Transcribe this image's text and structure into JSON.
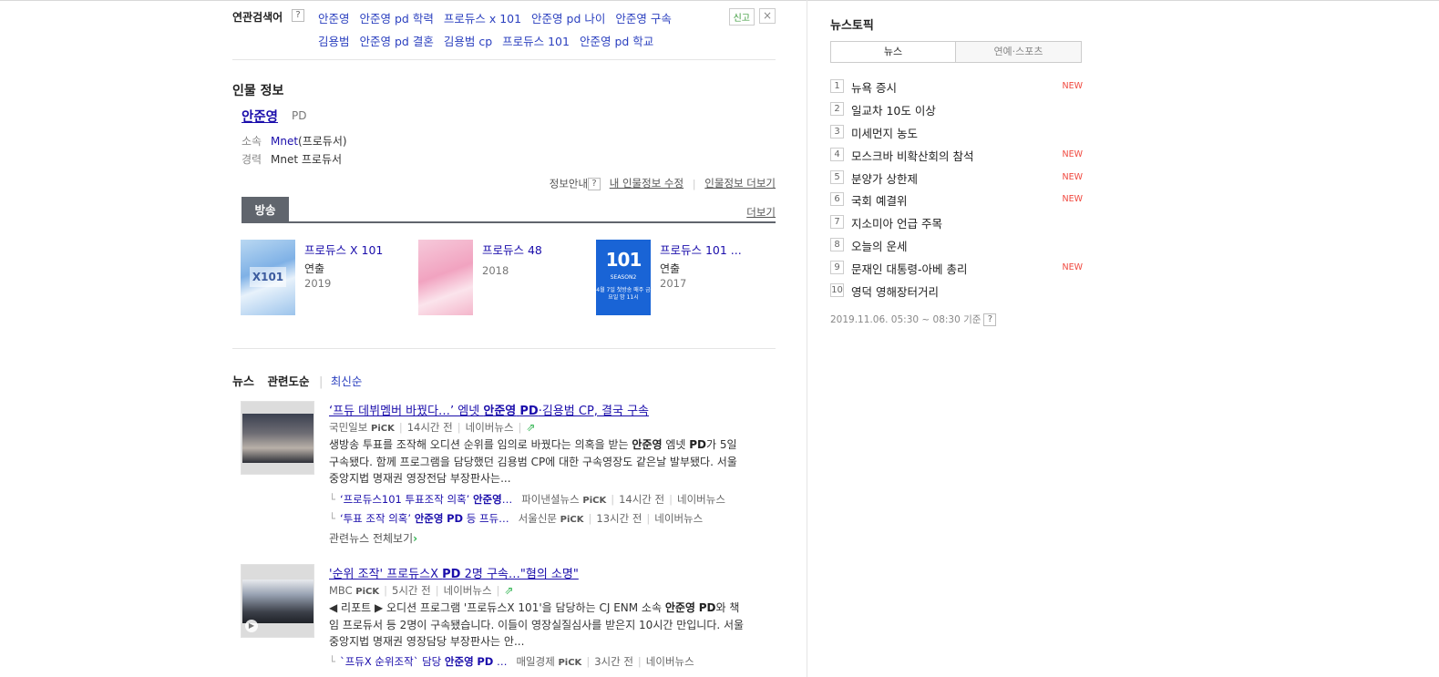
{
  "related": {
    "title": "연관검색어",
    "help": "?",
    "report": "신고",
    "close": "×",
    "links": [
      "안준영",
      "안준영 pd 학력",
      "프로듀스 x 101",
      "안준영 pd 나이",
      "안준영 구속",
      "김용범",
      "안준영 pd 결혼",
      "김용범 cp",
      "프로듀스 101",
      "안준영 pd 학교"
    ]
  },
  "person": {
    "heading": "인물 정보",
    "name": "안준영",
    "role": "PD",
    "affiliation_label": "소속",
    "affiliation_link": "Mnet",
    "affiliation_rest": "(프로듀서)",
    "career_label": "경력",
    "career_value": "Mnet 프로듀서",
    "info_guide": "정보안내",
    "info_help": "?",
    "edit": "내 인물정보 수정",
    "more": "인물정보 더보기"
  },
  "broadcast": {
    "tab": "방송",
    "more": "더보기",
    "items": [
      {
        "title": "프로듀스 X 101",
        "role": "연출",
        "year": "2019",
        "poster_text": "X101"
      },
      {
        "title": "프로듀스 48",
        "role": "",
        "year": "2018",
        "poster_text": ""
      },
      {
        "title": "프로듀스 101 ...",
        "role": "연출",
        "year": "2017",
        "poster_text": "101",
        "poster_sub": "SEASON2",
        "poster_air": "4월 7일 첫방송 매주 금요일 밤 11시"
      }
    ]
  },
  "news": {
    "heading": "뉴스",
    "sort_relevance": "관련도순",
    "sort_latest": "최신순",
    "articles": [
      {
        "title": "‘프듀 데뷔멤버 바꿨다…’ 엠넷 안준영 PD·김용범 CP, 결국 구속",
        "source": "국민일보",
        "pick": "PiCK",
        "time": "14시간 전",
        "portal": "네이버뉴스",
        "body_line1": "생방송 투표를 조작해 오디션 순위를 임의로 바꿨다는 의혹을 받는 안준영 엠넷 PD가 5일",
        "body_line2": "구속됐다. 함께 프로그램을 담당했던 김용범 CP에 대한 구속영장도 같은날 발부됐다. 서울",
        "body_line3": "중앙지법 명재권 영장전담 부장판사는...",
        "subs": [
          {
            "title": "‘프로듀스101 투표조작 의혹’ 안준영…",
            "source": "파이낸셜뉴스",
            "pick": "PiCK",
            "time": "14시간 전",
            "portal": "네이버뉴스"
          },
          {
            "title": "‘투표 조작 의혹’ 안준영 PD 등 프듀…",
            "source": "서울신문",
            "pick": "PiCK",
            "time": "13시간 전",
            "portal": "네이버뉴스"
          }
        ],
        "more": "관련뉴스 전체보기"
      },
      {
        "title": "'순위 조작' 프로듀스X PD 2명 구속…\"혐의 소명\"",
        "source": "MBC",
        "pick": "PiCK",
        "time": "5시간 전",
        "portal": "네이버뉴스",
        "body_line1": "◀ 리포트 ▶ 오디션 프로그램 '프로듀스X 101'을 담당하는 CJ ENM 소속 안준영 PD와 책",
        "body_line2": "임 프로듀서 등 2명이 구속됐습니다. 이들이 영장실질심사를 받은지 10시간 만입니다. 서울",
        "body_line3": "중앙지법 명재권 영장담당 부장판사는 안...",
        "subs": [
          {
            "title": "`프듀X 순위조작` 담당 안준영 PD …",
            "source": "매일경제",
            "pick": "PiCK",
            "time": "3시간 전",
            "portal": "네이버뉴스"
          }
        ]
      }
    ]
  },
  "side": {
    "heading": "뉴스토픽",
    "tab_news": "뉴스",
    "tab_ent": "연예·스포츠",
    "topics": [
      {
        "rank": "1",
        "text": "뉴욕 증시",
        "badge": "NEW"
      },
      {
        "rank": "2",
        "text": "일교차 10도 이상",
        "badge": ""
      },
      {
        "rank": "3",
        "text": "미세먼지 농도",
        "badge": ""
      },
      {
        "rank": "4",
        "text": "모스크바 비확산회의 참석",
        "badge": "NEW"
      },
      {
        "rank": "5",
        "text": "분양가 상한제",
        "badge": "NEW"
      },
      {
        "rank": "6",
        "text": "국회 예결위",
        "badge": "NEW"
      },
      {
        "rank": "7",
        "text": "지소미아 언급 주목",
        "badge": ""
      },
      {
        "rank": "8",
        "text": "오늘의 운세",
        "badge": ""
      },
      {
        "rank": "9",
        "text": "문재인 대통령-아베 총리",
        "badge": "NEW"
      },
      {
        "rank": "10",
        "text": "영덕 영해장터거리",
        "badge": ""
      }
    ],
    "basis": "2019.11.06. 05:30 ~ 08:30 기준",
    "basis_help": "?"
  },
  "colors": {
    "accent_link": "#1a0dab",
    "tab_dark": "#60656d",
    "new_badge": "#f0483e",
    "share_green": "#2bb24c"
  }
}
